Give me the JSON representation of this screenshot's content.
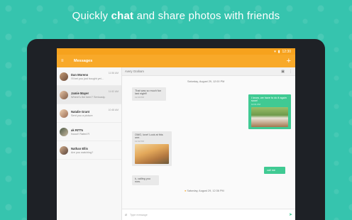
{
  "headline": {
    "pre": "Quickly ",
    "bold": "chat",
    "post": " and share photos with friends"
  },
  "status": {
    "time": "12:30"
  },
  "appbar": {
    "title": "Messages",
    "menu_glyph": "≡",
    "add_glyph": "+"
  },
  "conversations": [
    {
      "name": "Dan Moreno",
      "snippet": "I'll bet you just bought yet...",
      "time": "11:56 AM",
      "active": false
    },
    {
      "name": "Jamie Mayer",
      "snippet": "Where's the beer? Seriously...",
      "time": "11:52 AM",
      "active": true
    },
    {
      "name": "Natalie Grant",
      "snippet": "Sent you a picture",
      "time": "10:48 AM",
      "active": false
    },
    {
      "name": "ak RITTs",
      "snippet": "Nooo!! Rated R",
      "time": "",
      "active": false
    },
    {
      "name": "Nathan Ellis",
      "snippet": "Are you watching?",
      "time": "",
      "active": false
    }
  ],
  "chat": {
    "contact": "Avery Graham",
    "date1": "Saturday, August 29, 12:00 PM",
    "date2": "Saturday, August 29, 12:36 PM",
    "messages": [
      {
        "text": "That was so much fun last night!!",
        "meta": "12:00 PM",
        "dir": "in"
      },
      {
        "text": "I know, we have to do it again soon!",
        "meta": "12:01 PM",
        "dir": "out"
      },
      {
        "text": "OMG, love! Look at this one.",
        "meta": "12:02 PM",
        "dir": "in"
      },
      {
        "text": "call me",
        "meta": "12:35 PM",
        "dir": "out"
      },
      {
        "text": "k, calling you now.",
        "meta": "12:35 PM",
        "dir": "in"
      }
    ]
  },
  "composer": {
    "placeholder": "Type message"
  },
  "colors": {
    "brand": "#f8a929",
    "accent": "#40ca93",
    "background": "#36c4ae"
  }
}
